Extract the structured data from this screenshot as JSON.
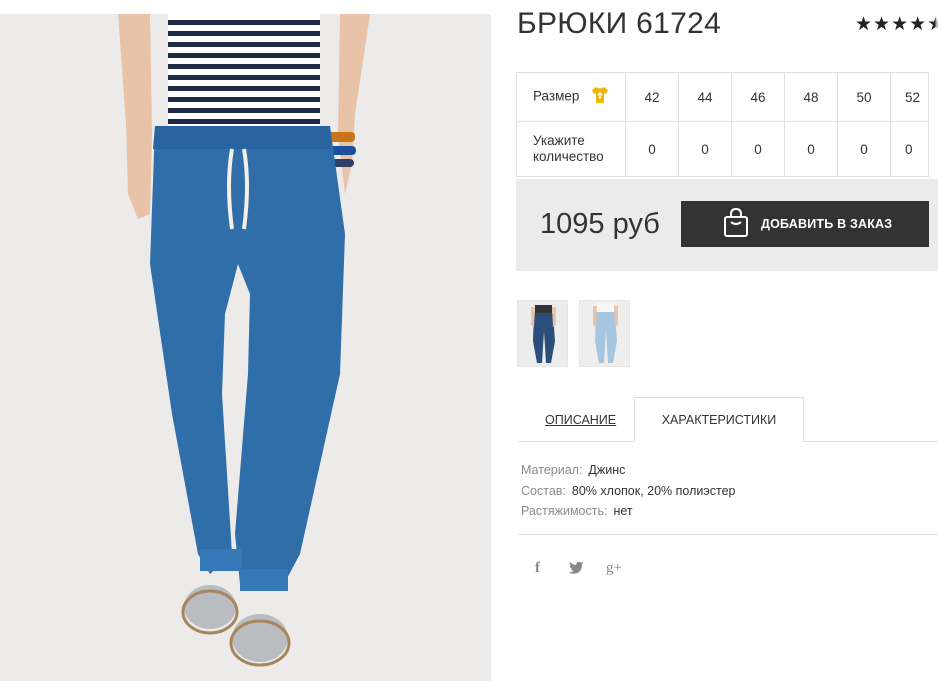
{
  "product": {
    "title": "БРЮКИ 61724",
    "rating_stars": 4.5,
    "main_image_icon": "jeans-photo-icon"
  },
  "sizes": {
    "label": "Размер",
    "values": [
      "42",
      "44",
      "46",
      "48",
      "50",
      "52"
    ],
    "quantity_label": "Укажите количество",
    "quantities": [
      "0",
      "0",
      "0",
      "0",
      "0",
      "0"
    ],
    "icon": "tshirt-icon",
    "icon_color": "#f2b705"
  },
  "order": {
    "price": "1095 руб",
    "add_button_label": "ДОБАВИТЬ В ЗАКАЗ",
    "button_icon": "shopping-bag-icon"
  },
  "thumbnails": [
    "dark-blue-jeans-thumb",
    "light-blue-jeans-thumb"
  ],
  "tabs": {
    "description": "ОПИСАНИЕ",
    "characteristics": "ХАРАКТЕРИСТИКИ",
    "active": "characteristics"
  },
  "characteristics": [
    {
      "key": "Материал:",
      "value": "Джинс"
    },
    {
      "key": "Состав:",
      "value": "80% хлопок, 20% полиэстер"
    },
    {
      "key": "Растяжимость:",
      "value": "нет"
    }
  ],
  "social": {
    "facebook": "f",
    "twitter": "twitter-icon",
    "googleplus": "g+"
  },
  "colors": {
    "button_bg": "#333333",
    "price_box_bg": "#ebebeb",
    "jeans_blue": "#2f6ea8"
  }
}
